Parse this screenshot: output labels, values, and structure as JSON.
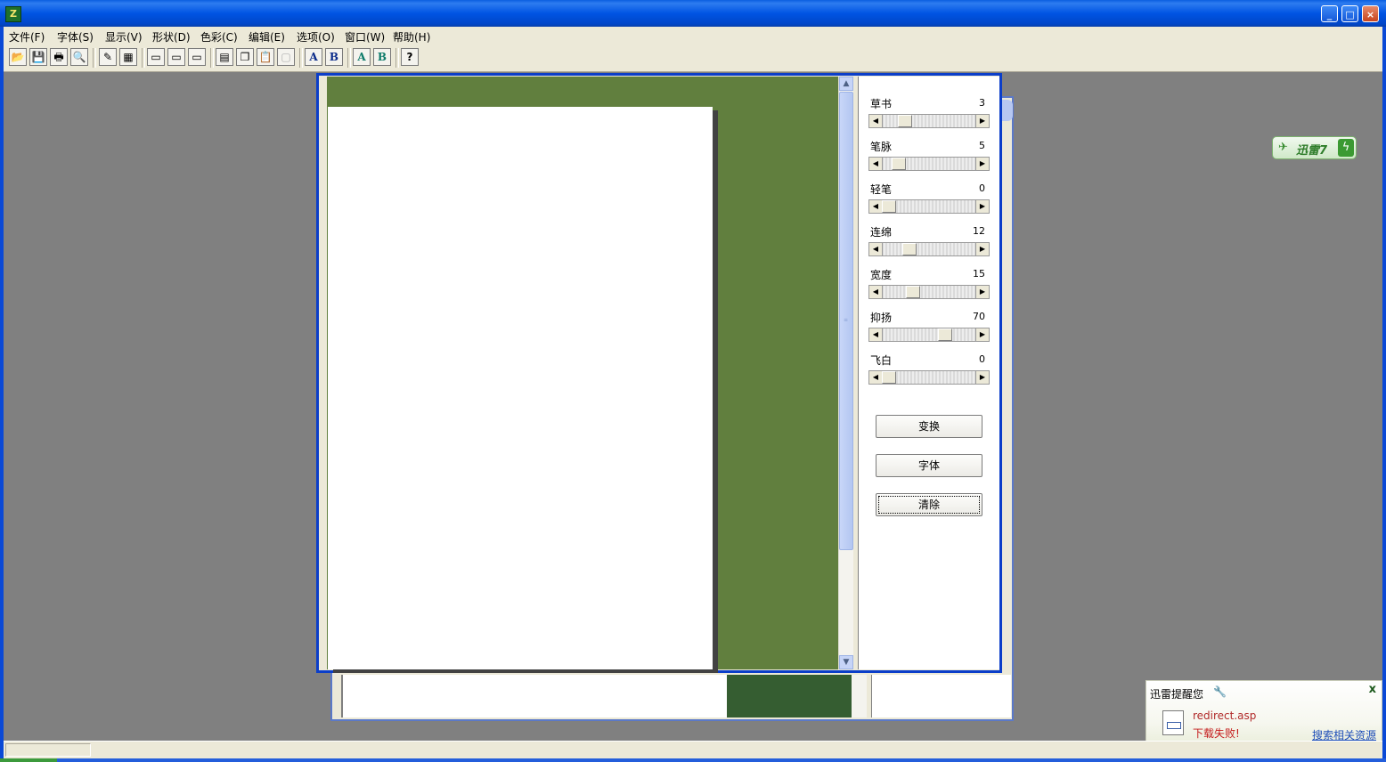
{
  "menubar": {
    "items": [
      "文件(F)",
      "字体(S)",
      "显示(V)",
      "形状(D)",
      "色彩(C)",
      "编辑(E)",
      "选项(O)",
      "窗口(W)",
      "帮助(H)"
    ]
  },
  "window_controls": {
    "minimize": "_",
    "maximize": "□",
    "close": "×"
  },
  "app_icon_glyph": "Z",
  "toolbar": {
    "buttons": [
      {
        "name": "open-icon",
        "glyph": "📂"
      },
      {
        "name": "save-icon",
        "glyph": "💾"
      },
      {
        "name": "print-icon",
        "glyph": "🖶"
      },
      {
        "name": "print-preview-icon",
        "glyph": "🔍"
      },
      {
        "name": "pen-icon",
        "glyph": "✎"
      },
      {
        "name": "grid-icon",
        "glyph": "▦"
      },
      {
        "name": "layout-1-icon",
        "glyph": "▭"
      },
      {
        "name": "layout-2-icon",
        "glyph": "▭"
      },
      {
        "name": "layout-3-icon",
        "glyph": "▭"
      },
      {
        "name": "cut-icon",
        "glyph": "▤"
      },
      {
        "name": "copy-icon",
        "glyph": "❐"
      },
      {
        "name": "paste-icon",
        "glyph": "📋"
      },
      {
        "name": "disabled-icon",
        "glyph": "▢"
      },
      {
        "name": "font-a-icon",
        "glyph": "A"
      },
      {
        "name": "font-b-icon",
        "glyph": "B"
      },
      {
        "name": "color-a-icon",
        "glyph": "A"
      },
      {
        "name": "color-b-icon",
        "glyph": "B"
      },
      {
        "name": "help-icon",
        "glyph": "?"
      }
    ]
  },
  "panel": {
    "sliders": [
      {
        "label": "草书",
        "value": "3",
        "level": 0.2
      },
      {
        "label": "笔脉",
        "value": "5",
        "level": 0.12
      },
      {
        "label": "轻笔",
        "value": "0",
        "level": 0.0
      },
      {
        "label": "连绵",
        "value": "12",
        "level": 0.25
      },
      {
        "label": "宽度",
        "value": "15",
        "level": 0.3
      },
      {
        "label": "抑扬",
        "value": "70",
        "level": 0.7
      },
      {
        "label": "飞白",
        "value": "0",
        "level": 0.0
      }
    ],
    "buttons": {
      "transform": "变换",
      "font": "字体",
      "clear": "清除"
    }
  },
  "thunder_badge": {
    "text": "迅雷7",
    "bird": "✈",
    "bolt": "ϟ"
  },
  "notification": {
    "title": "迅雷提醒您",
    "filename": "redirect.asp",
    "status": "下载失败!",
    "search_link": "搜索相关资源",
    "close": "x",
    "wrench": "🔧"
  },
  "colors": {
    "canvas_green": "#617f3e",
    "xp_blue": "#0054e3",
    "dialog_bg": "#ece9d8"
  }
}
